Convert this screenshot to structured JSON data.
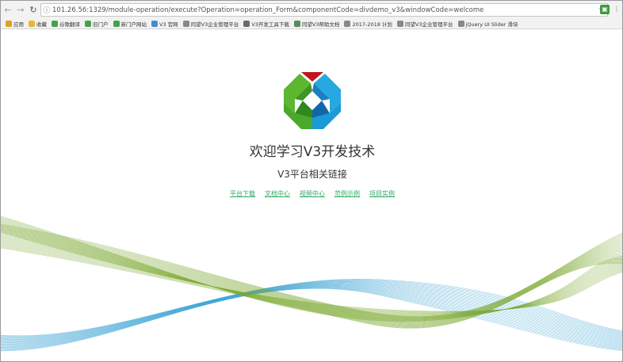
{
  "browser": {
    "url": "101.26.56:1329/module-operation/execute?Operation=operation_Form&componentCode=divdemo_v3&windowCode=welcome",
    "back_icon": "arrow-left",
    "forward_icon": "arrow-right",
    "reload_icon": "reload",
    "star_icon": "star"
  },
  "bookmarks": [
    {
      "label": "应用",
      "color": "#e0a020",
      "icon": "apps-grid-icon"
    },
    {
      "label": "收藏",
      "color": "#e8b830",
      "icon": "folder-icon"
    },
    {
      "label": "谷歌翻译",
      "color": "#4aa04a",
      "icon": "globe-icon"
    },
    {
      "label": "旧门户",
      "color": "#4aa04a",
      "icon": "globe-icon"
    },
    {
      "label": "新门户网站",
      "color": "#4aa04a",
      "icon": "globe-icon"
    },
    {
      "label": "V3 官网",
      "color": "#4a8ad0",
      "icon": "globe-icon"
    },
    {
      "label": "同望V3企业管理平台",
      "color": "#888888",
      "icon": "page-icon"
    },
    {
      "label": "V3开发工具下载",
      "color": "#6a6a6a",
      "icon": "gear-icon"
    },
    {
      "label": "同望V3帮助文档",
      "color": "#5a8a5a",
      "icon": "person-icon"
    },
    {
      "label": "2017-2018 计划",
      "color": "#888888",
      "icon": "page-icon"
    },
    {
      "label": "同望V3企业管理平台",
      "color": "#888888",
      "icon": "page-icon"
    },
    {
      "label": "jQuery UI Slider 滑块",
      "color": "#888888",
      "icon": "page-icon"
    }
  ],
  "page": {
    "welcome": "欢迎学习V3开发技术",
    "subtitle": "V3平台相关链接",
    "links": [
      "平台下载",
      "文档中心",
      "视频中心",
      "范例示例",
      "项目实例"
    ]
  },
  "colors": {
    "link": "#33aa66",
    "logo_green": "#5cb82e",
    "logo_blue": "#1a9ad6",
    "logo_red": "#c0161d",
    "wave_green": "#7aa830",
    "wave_blue": "#2a9ad0"
  }
}
